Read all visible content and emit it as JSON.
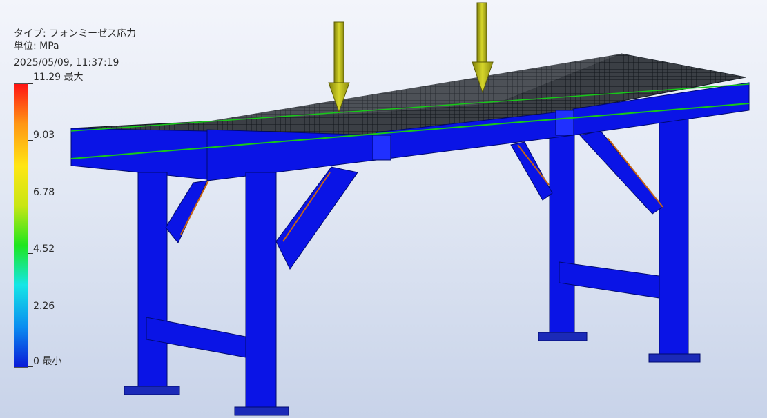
{
  "result": {
    "type_label": "タイプ: フォンミーゼス応力",
    "unit_label": "単位: MPa",
    "timestamp": "2025/05/09, 11:37:19"
  },
  "legend": {
    "ticks": [
      {
        "value_text": "11.29 最大",
        "fraction": 1.0
      },
      {
        "value_text": "9.03",
        "fraction": 0.8
      },
      {
        "value_text": "6.78",
        "fraction": 0.6
      },
      {
        "value_text": "4.52",
        "fraction": 0.4
      },
      {
        "value_text": "2.26",
        "fraction": 0.2
      },
      {
        "value_text": "0 最小",
        "fraction": 0.0
      }
    ],
    "colors": [
      "#0a1ad8",
      "#0a8cf0",
      "#14e6e6",
      "#1ee61e",
      "#c8e614",
      "#ffe614",
      "#ff9614",
      "#ff1414"
    ]
  },
  "model": {
    "structure_color": "#0a14e6",
    "load_arrow_color": "#b4b414",
    "load_arrow_count": 2
  }
}
